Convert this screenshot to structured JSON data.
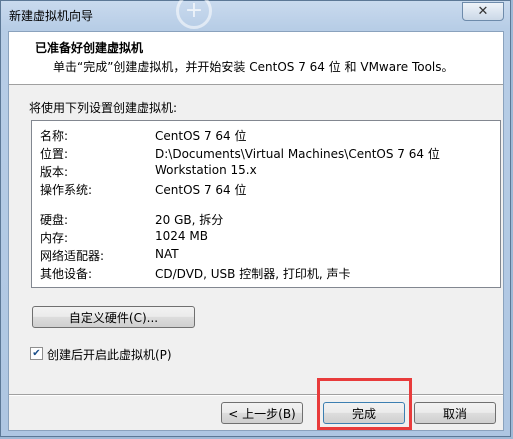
{
  "window": {
    "title": "新建虚拟机向导",
    "close_glyph": "✕"
  },
  "header": {
    "title": "已准备好创建虚拟机",
    "subtitle": "单击“完成”创建虚拟机，并开始安装 CentOS 7 64 位 和 VMware Tools。"
  },
  "summary": {
    "label": "将使用下列设置创建虚拟机:",
    "rows": [
      {
        "key": "名称:",
        "value": "CentOS 7 64 位"
      },
      {
        "key": "位置:",
        "value": "D:\\Documents\\Virtual Machines\\CentOS 7 64 位"
      },
      {
        "key": "版本:",
        "value": "Workstation 15.x"
      },
      {
        "key": "操作系统:",
        "value": "CentOS 7 64 位"
      },
      {
        "key": "硬盘:",
        "value": "20 GB, 拆分"
      },
      {
        "key": "内存:",
        "value": "1024 MB"
      },
      {
        "key": "网络适配器:",
        "value": "NAT"
      },
      {
        "key": "其他设备:",
        "value": "CD/DVD, USB 控制器, 打印机, 声卡"
      }
    ]
  },
  "buttons": {
    "customize_hardware": "自定义硬件(C)...",
    "back": "< 上一步(B)",
    "finish": "完成",
    "cancel": "取消"
  },
  "power_on": {
    "label": "创建后开启此虚拟机(P)",
    "checked": true,
    "check_glyph": "✔"
  }
}
